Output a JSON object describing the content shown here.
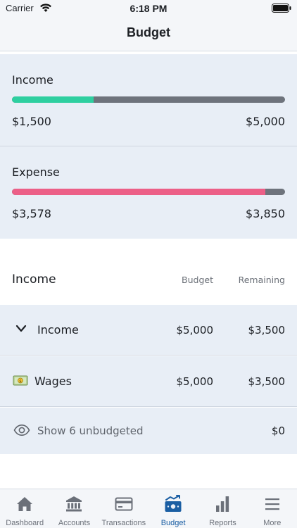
{
  "status_bar": {
    "carrier": "Carrier",
    "time": "6:18 PM"
  },
  "nav": {
    "title": "Budget"
  },
  "summary": {
    "income": {
      "label": "Income",
      "current": "$1,500",
      "total": "$5,000",
      "progress": 0.3
    },
    "expense": {
      "label": "Expense",
      "current": "$3,578",
      "total": "$3,850",
      "progress": 0.929
    }
  },
  "table": {
    "title": "Income",
    "col_budget": "Budget",
    "col_remaining": "Remaining",
    "rows": [
      {
        "label": "Income",
        "budget": "$5,000",
        "remaining": "$3,500",
        "icon": "chevron-down-icon"
      },
      {
        "label": "Wages",
        "budget": "$5,000",
        "remaining": "$3,500",
        "icon": "money-icon"
      }
    ],
    "unbudgeted": {
      "label": "Show 6 unbudgeted",
      "remaining": "$0",
      "icon": "eye-icon"
    }
  },
  "tabs": [
    {
      "label": "Dashboard",
      "icon": "home-icon",
      "active": false
    },
    {
      "label": "Accounts",
      "icon": "bank-icon",
      "active": false
    },
    {
      "label": "Transactions",
      "icon": "card-icon",
      "active": false
    },
    {
      "label": "Budget",
      "icon": "budget-icon",
      "active": true
    },
    {
      "label": "Reports",
      "icon": "bar-chart-icon",
      "active": false
    },
    {
      "label": "More",
      "icon": "menu-icon",
      "active": false
    }
  ],
  "colors": {
    "accent": "#1a5ea3",
    "income_bar": "#2ecfa0",
    "expense_bar": "#ec5f87",
    "track": "#6e737c"
  }
}
